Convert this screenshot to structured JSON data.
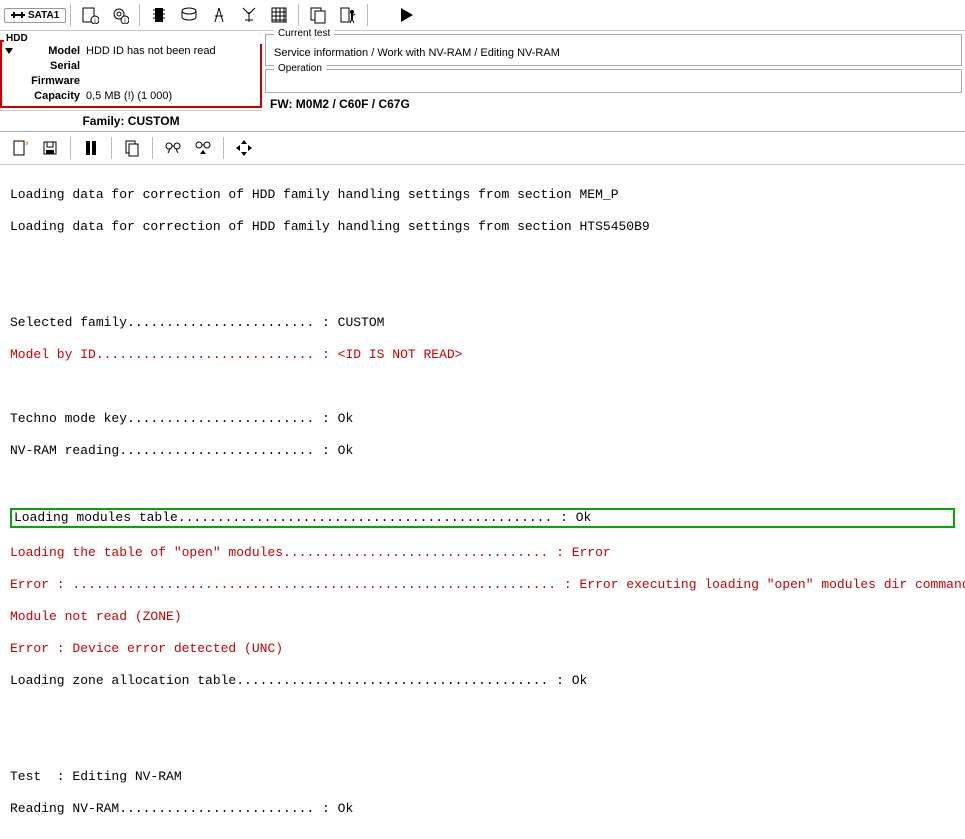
{
  "top_tab": {
    "label": "SATA1"
  },
  "hdd": {
    "legend": "HDD",
    "model_label": "Model",
    "model_value": "HDD ID has not been read",
    "serial_label": "Serial",
    "serial_value": "",
    "firmware_label": "Firmware",
    "firmware_value": "",
    "capacity_label": "Capacity",
    "capacity_value": "0,5 MB (!) (1 000)",
    "family_line": "Family: CUSTOM"
  },
  "current_test": {
    "title": "Current test",
    "value": "Service information / Work with NV-RAM / Editing NV-RAM"
  },
  "operation": {
    "title": "Operation",
    "value": ""
  },
  "fw_line": "FW: M0M2 / C60F / C67G",
  "log": {
    "l1": "Loading data for correction of HDD family handling settings from section MEM_P",
    "l2": "Loading data for correction of HDD family handling settings from section HTS5450B9",
    "blank": "",
    "l3": "Selected family........................ : CUSTOM",
    "l4": "Model by ID............................ : <ID IS NOT READ>",
    "l5": "Techno mode key........................ : Ok",
    "l6": "NV-RAM reading......................... : Ok",
    "l7": "Loading modules table................................................ : Ok",
    "l8": "Loading the table of \"open\" modules.................................. : Error",
    "l9": "Error : .............................................................. : Error executing loading \"open\" modules dir command",
    "l10": "Module not read (ZONE)",
    "l11": "Error : Device error detected (UNC)",
    "l12": "Loading zone allocation table........................................ : Ok",
    "l13": "Test  : Editing NV-RAM",
    "l14": "Reading NV-RAM......................... : Ok"
  }
}
